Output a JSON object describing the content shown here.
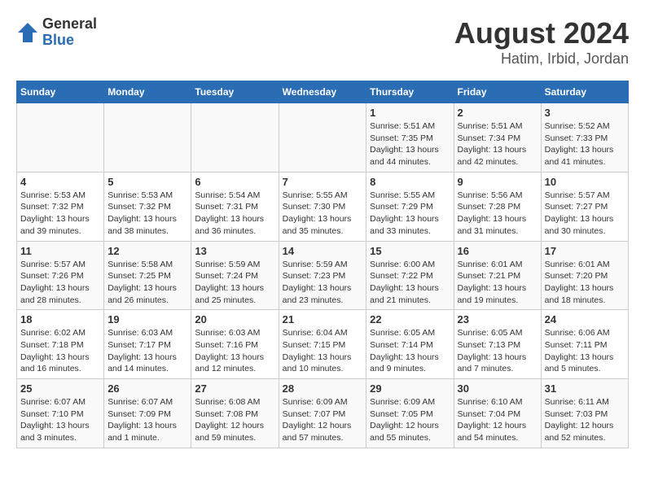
{
  "header": {
    "logo_general": "General",
    "logo_blue": "Blue",
    "month_year": "August 2024",
    "location": "Hatim, Irbid, Jordan"
  },
  "weekdays": [
    "Sunday",
    "Monday",
    "Tuesday",
    "Wednesday",
    "Thursday",
    "Friday",
    "Saturday"
  ],
  "weeks": [
    [
      {
        "day": "",
        "sunrise": "",
        "sunset": "",
        "daylight": ""
      },
      {
        "day": "",
        "sunrise": "",
        "sunset": "",
        "daylight": ""
      },
      {
        "day": "",
        "sunrise": "",
        "sunset": "",
        "daylight": ""
      },
      {
        "day": "",
        "sunrise": "",
        "sunset": "",
        "daylight": ""
      },
      {
        "day": "1",
        "sunrise": "Sunrise: 5:51 AM",
        "sunset": "Sunset: 7:35 PM",
        "daylight": "Daylight: 13 hours and 44 minutes."
      },
      {
        "day": "2",
        "sunrise": "Sunrise: 5:51 AM",
        "sunset": "Sunset: 7:34 PM",
        "daylight": "Daylight: 13 hours and 42 minutes."
      },
      {
        "day": "3",
        "sunrise": "Sunrise: 5:52 AM",
        "sunset": "Sunset: 7:33 PM",
        "daylight": "Daylight: 13 hours and 41 minutes."
      }
    ],
    [
      {
        "day": "4",
        "sunrise": "Sunrise: 5:53 AM",
        "sunset": "Sunset: 7:32 PM",
        "daylight": "Daylight: 13 hours and 39 minutes."
      },
      {
        "day": "5",
        "sunrise": "Sunrise: 5:53 AM",
        "sunset": "Sunset: 7:32 PM",
        "daylight": "Daylight: 13 hours and 38 minutes."
      },
      {
        "day": "6",
        "sunrise": "Sunrise: 5:54 AM",
        "sunset": "Sunset: 7:31 PM",
        "daylight": "Daylight: 13 hours and 36 minutes."
      },
      {
        "day": "7",
        "sunrise": "Sunrise: 5:55 AM",
        "sunset": "Sunset: 7:30 PM",
        "daylight": "Daylight: 13 hours and 35 minutes."
      },
      {
        "day": "8",
        "sunrise": "Sunrise: 5:55 AM",
        "sunset": "Sunset: 7:29 PM",
        "daylight": "Daylight: 13 hours and 33 minutes."
      },
      {
        "day": "9",
        "sunrise": "Sunrise: 5:56 AM",
        "sunset": "Sunset: 7:28 PM",
        "daylight": "Daylight: 13 hours and 31 minutes."
      },
      {
        "day": "10",
        "sunrise": "Sunrise: 5:57 AM",
        "sunset": "Sunset: 7:27 PM",
        "daylight": "Daylight: 13 hours and 30 minutes."
      }
    ],
    [
      {
        "day": "11",
        "sunrise": "Sunrise: 5:57 AM",
        "sunset": "Sunset: 7:26 PM",
        "daylight": "Daylight: 13 hours and 28 minutes."
      },
      {
        "day": "12",
        "sunrise": "Sunrise: 5:58 AM",
        "sunset": "Sunset: 7:25 PM",
        "daylight": "Daylight: 13 hours and 26 minutes."
      },
      {
        "day": "13",
        "sunrise": "Sunrise: 5:59 AM",
        "sunset": "Sunset: 7:24 PM",
        "daylight": "Daylight: 13 hours and 25 minutes."
      },
      {
        "day": "14",
        "sunrise": "Sunrise: 5:59 AM",
        "sunset": "Sunset: 7:23 PM",
        "daylight": "Daylight: 13 hours and 23 minutes."
      },
      {
        "day": "15",
        "sunrise": "Sunrise: 6:00 AM",
        "sunset": "Sunset: 7:22 PM",
        "daylight": "Daylight: 13 hours and 21 minutes."
      },
      {
        "day": "16",
        "sunrise": "Sunrise: 6:01 AM",
        "sunset": "Sunset: 7:21 PM",
        "daylight": "Daylight: 13 hours and 19 minutes."
      },
      {
        "day": "17",
        "sunrise": "Sunrise: 6:01 AM",
        "sunset": "Sunset: 7:20 PM",
        "daylight": "Daylight: 13 hours and 18 minutes."
      }
    ],
    [
      {
        "day": "18",
        "sunrise": "Sunrise: 6:02 AM",
        "sunset": "Sunset: 7:18 PM",
        "daylight": "Daylight: 13 hours and 16 minutes."
      },
      {
        "day": "19",
        "sunrise": "Sunrise: 6:03 AM",
        "sunset": "Sunset: 7:17 PM",
        "daylight": "Daylight: 13 hours and 14 minutes."
      },
      {
        "day": "20",
        "sunrise": "Sunrise: 6:03 AM",
        "sunset": "Sunset: 7:16 PM",
        "daylight": "Daylight: 13 hours and 12 minutes."
      },
      {
        "day": "21",
        "sunrise": "Sunrise: 6:04 AM",
        "sunset": "Sunset: 7:15 PM",
        "daylight": "Daylight: 13 hours and 10 minutes."
      },
      {
        "day": "22",
        "sunrise": "Sunrise: 6:05 AM",
        "sunset": "Sunset: 7:14 PM",
        "daylight": "Daylight: 13 hours and 9 minutes."
      },
      {
        "day": "23",
        "sunrise": "Sunrise: 6:05 AM",
        "sunset": "Sunset: 7:13 PM",
        "daylight": "Daylight: 13 hours and 7 minutes."
      },
      {
        "day": "24",
        "sunrise": "Sunrise: 6:06 AM",
        "sunset": "Sunset: 7:11 PM",
        "daylight": "Daylight: 13 hours and 5 minutes."
      }
    ],
    [
      {
        "day": "25",
        "sunrise": "Sunrise: 6:07 AM",
        "sunset": "Sunset: 7:10 PM",
        "daylight": "Daylight: 13 hours and 3 minutes."
      },
      {
        "day": "26",
        "sunrise": "Sunrise: 6:07 AM",
        "sunset": "Sunset: 7:09 PM",
        "daylight": "Daylight: 13 hours and 1 minute."
      },
      {
        "day": "27",
        "sunrise": "Sunrise: 6:08 AM",
        "sunset": "Sunset: 7:08 PM",
        "daylight": "Daylight: 12 hours and 59 minutes."
      },
      {
        "day": "28",
        "sunrise": "Sunrise: 6:09 AM",
        "sunset": "Sunset: 7:07 PM",
        "daylight": "Daylight: 12 hours and 57 minutes."
      },
      {
        "day": "29",
        "sunrise": "Sunrise: 6:09 AM",
        "sunset": "Sunset: 7:05 PM",
        "daylight": "Daylight: 12 hours and 55 minutes."
      },
      {
        "day": "30",
        "sunrise": "Sunrise: 6:10 AM",
        "sunset": "Sunset: 7:04 PM",
        "daylight": "Daylight: 12 hours and 54 minutes."
      },
      {
        "day": "31",
        "sunrise": "Sunrise: 6:11 AM",
        "sunset": "Sunset: 7:03 PM",
        "daylight": "Daylight: 12 hours and 52 minutes."
      }
    ]
  ]
}
